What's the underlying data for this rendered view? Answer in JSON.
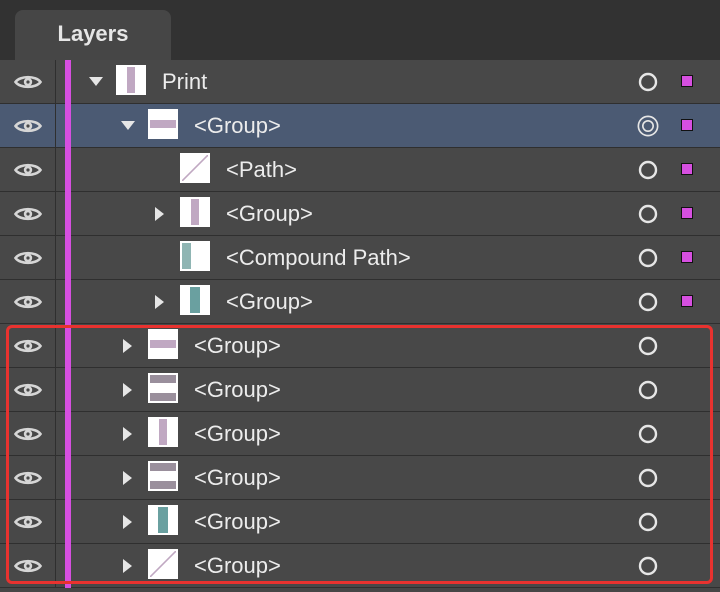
{
  "panel": {
    "tab_label": "Layers"
  },
  "colors": {
    "layer_color": "#d64fe0",
    "selected_row": "#4b5a73",
    "annotation": "#e8322f"
  },
  "icons": {
    "visibility": "eye-icon",
    "target": "target-circle-icon",
    "expand": "disclosure-triangle-icon"
  },
  "rows": [
    {
      "label": "Print",
      "depth": 0,
      "state": "expanded",
      "thumb": "vstripe",
      "selected": false,
      "targeted": false,
      "has_selection": true
    },
    {
      "label": "<Group>",
      "depth": 1,
      "state": "expanded",
      "thumb": "hstripe",
      "selected": true,
      "targeted": true,
      "has_selection": true
    },
    {
      "label": "<Path>",
      "depth": 2,
      "state": "none",
      "thumb": "diagonal",
      "selected": false,
      "targeted": false,
      "has_selection": true
    },
    {
      "label": "<Group>",
      "depth": 2,
      "state": "collapsed",
      "thumb": "vstripe",
      "selected": false,
      "targeted": false,
      "has_selection": true
    },
    {
      "label": "<Compound Path>",
      "depth": 2,
      "state": "none",
      "thumb": "leftteal",
      "selected": false,
      "targeted": false,
      "has_selection": true
    },
    {
      "label": "<Group>",
      "depth": 2,
      "state": "collapsed",
      "thumb": "tealstripe",
      "selected": false,
      "targeted": false,
      "has_selection": true
    },
    {
      "label": "<Group>",
      "depth": 1,
      "state": "collapsed",
      "thumb": "hstripe",
      "selected": false,
      "targeted": false,
      "has_selection": false
    },
    {
      "label": "<Group>",
      "depth": 1,
      "state": "collapsed",
      "thumb": "hbands",
      "selected": false,
      "targeted": false,
      "has_selection": false
    },
    {
      "label": "<Group>",
      "depth": 1,
      "state": "collapsed",
      "thumb": "vstripe",
      "selected": false,
      "targeted": false,
      "has_selection": false
    },
    {
      "label": "<Group>",
      "depth": 1,
      "state": "collapsed",
      "thumb": "hbands",
      "selected": false,
      "targeted": false,
      "has_selection": false
    },
    {
      "label": "<Group>",
      "depth": 1,
      "state": "collapsed",
      "thumb": "tealstripe",
      "selected": false,
      "targeted": false,
      "has_selection": false
    },
    {
      "label": "<Group>",
      "depth": 1,
      "state": "collapsed",
      "thumb": "diagonal",
      "selected": false,
      "targeted": false,
      "has_selection": false
    }
  ]
}
